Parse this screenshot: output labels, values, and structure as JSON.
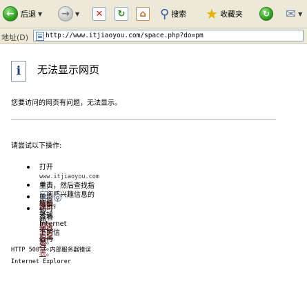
{
  "toolbar": {
    "back_label": "后退",
    "search_label": "搜索",
    "favorites_label": "收藏夹"
  },
  "address_bar": {
    "label": "地址(D)",
    "url": "http://www.itjiaoyou.com/space.php?do=pm"
  },
  "error": {
    "title": "无法显示网页",
    "description": "您要访问的网页有问题，无法显示。",
    "try_heading": "请尝试以下操作:",
    "suggestions": {
      "open_prefix": "打开",
      "open_site": "www.itjiaoyou.com",
      "open_suffix": "主页，然后查找指向您感兴趣信息的",
      "open_suffix2": "链接。",
      "refresh_prefix": "单击",
      "refresh_suffix": "刷新按钮，或以后再试。",
      "search_prefix": "单击",
      "search_link": "搜索",
      "search_suffix": "，寻找 Internet 上的信息。",
      "related_prefix": "也可查看",
      "related_link": "相关站点列表",
      "related_suffix": "。"
    },
    "footer_code": "HTTP 500 - 内部服务器错误",
    "footer_app": "Internet Explorer"
  },
  "colors": {
    "link": "#7a1a1a",
    "toolbar_bg": "#ece9d8"
  }
}
